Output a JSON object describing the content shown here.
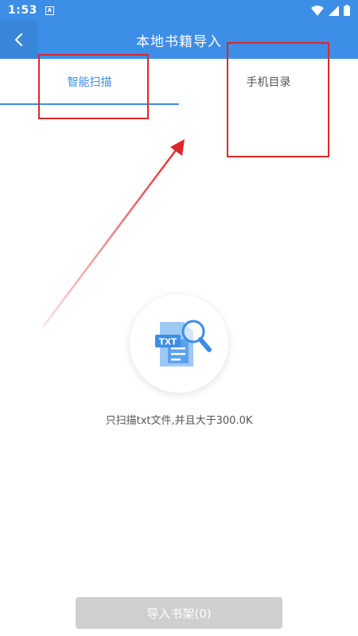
{
  "status_bar": {
    "time": "1:53",
    "notification_icon": "a-icon"
  },
  "header": {
    "title": "本地书籍导入",
    "back_icon": "chevron-left-icon"
  },
  "tabs": [
    {
      "label": "智能扫描",
      "active": true
    },
    {
      "label": "手机目录",
      "active": false
    }
  ],
  "scan": {
    "icon_text": "TXT",
    "hint": "只扫描txt文件,并且大于300.0K"
  },
  "import_button": {
    "label": "导入书架(0)",
    "enabled": false
  },
  "colors": {
    "primary": "#3d8ee6",
    "annotation": "#e0262b",
    "disabled": "#cfcfcf"
  }
}
